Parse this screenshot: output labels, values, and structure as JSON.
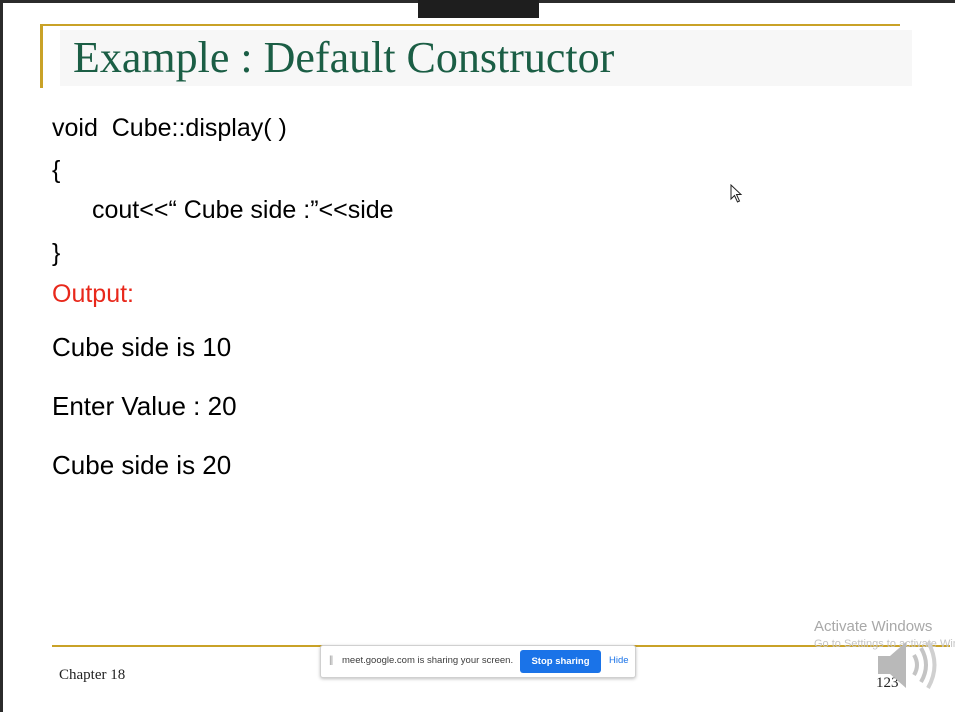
{
  "slide": {
    "title": "Example : Default Constructor",
    "code_lines": [
      "void  Cube::display( )",
      "{",
      "cout<<“ Cube side :”<<side",
      "}"
    ],
    "output_label": "Output:",
    "output_lines": [
      "Cube side is 10",
      "Enter Value : 20",
      "Cube side is 20"
    ],
    "footer_left": "Chapter 18",
    "page_number": "123"
  },
  "share_bar": {
    "grip": "||",
    "message": "meet.google.com is sharing your screen.",
    "stop_label": "Stop sharing",
    "hide_label": "Hide"
  },
  "watermark": {
    "title": "Activate Windows",
    "subtitle": "Go to Settings to activate Windows."
  },
  "icons": {
    "speaker": "speaker-icon",
    "cursor": "mouse-pointer-icon"
  },
  "colors": {
    "title": "#1b5e45",
    "accent_rule": "#c9a227",
    "output_label": "#e8281b",
    "stop_button": "#1a73e8"
  }
}
